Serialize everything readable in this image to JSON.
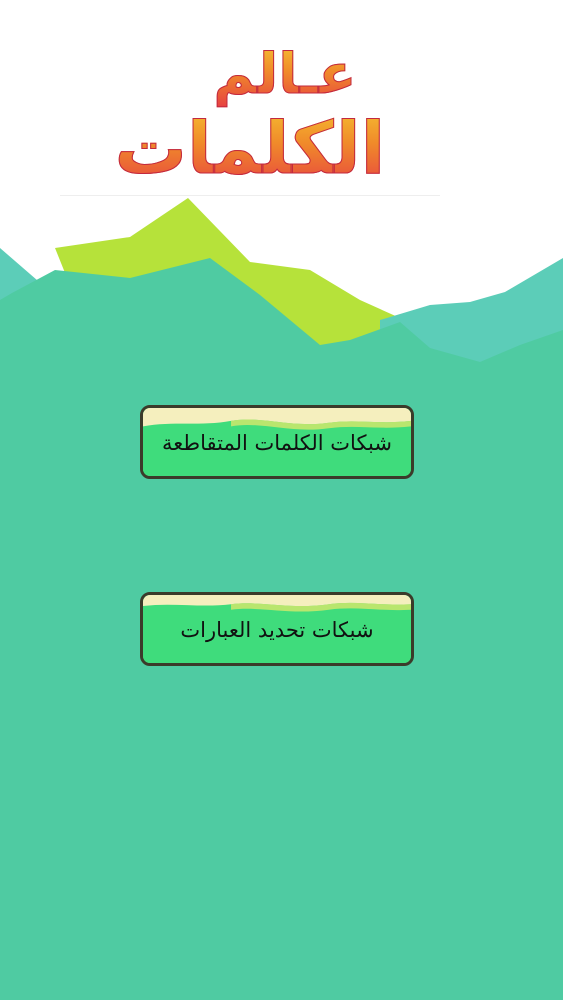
{
  "app": {
    "logo_line1": "عـالم",
    "logo_line2": "الكلمات"
  },
  "menu": {
    "crossword_label": "شبكات الكلمات المتقاطعة",
    "phrases_label": "شبكات تحديد العبارات"
  },
  "colors": {
    "background": "#ffffff",
    "teal_hill": "#4fcba2",
    "lime_hill": "#b6e23a",
    "light_teal_hill": "#5ccdb8",
    "button_fill": "#3fdc7c",
    "button_sand": "#f5efbe",
    "button_border": "#3b3b2a",
    "logo_gradient": [
      "#f6c531",
      "#f08a2a",
      "#e63b43"
    ]
  }
}
